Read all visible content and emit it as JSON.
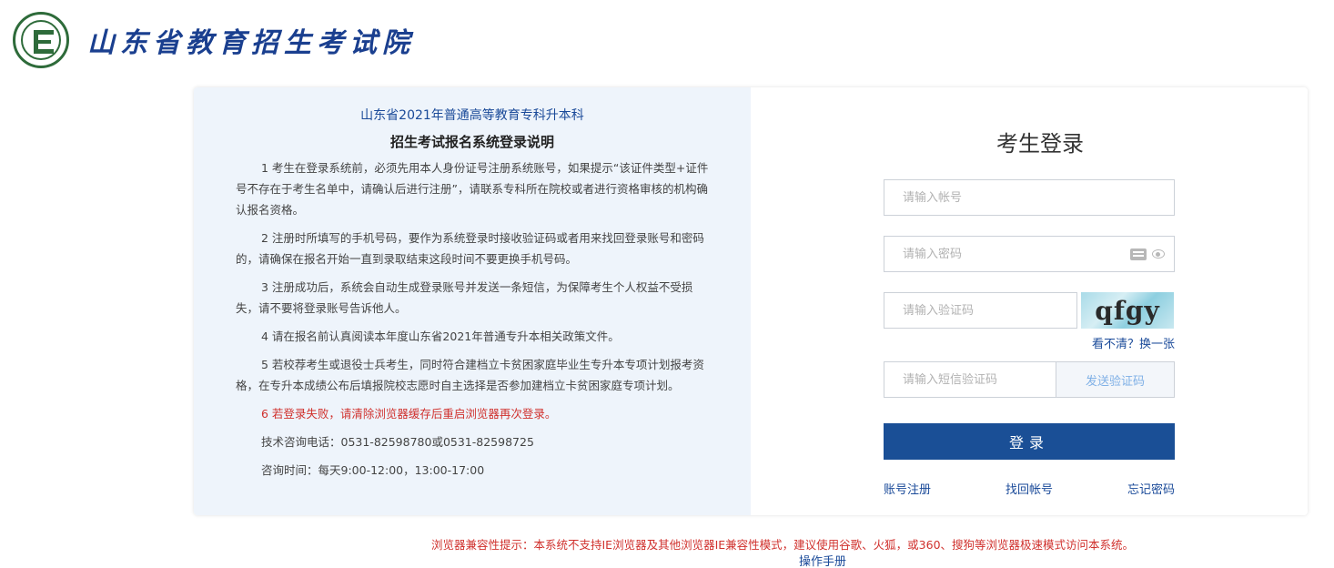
{
  "header": {
    "site_name": "山东省教育招生考试院"
  },
  "info": {
    "title": "山东省2021年普通高等教育专科升本科",
    "subtitle": "招生考试报名系统登录说明",
    "items": [
      "1 考生在登录系统前，必须先用本人身份证号注册系统账号，如果提示“该证件类型+证件号不存在于考生名单中，请确认后进行注册”，请联系专科所在院校或者进行资格审核的机构确认报名资格。",
      "2 注册时所填写的手机号码，要作为系统登录时接收验证码或者用来找回登录账号和密码的，请确保在报名开始一直到录取结束这段时间不要更换手机号码。",
      "3 注册成功后，系统会自动生成登录账号并发送一条短信，为保障考生个人权益不受损失，请不要将登录账号告诉他人。",
      "4 请在报名前认真阅读本年度山东省2021年普通专升本相关政策文件。",
      "5 若校荐考生或退役士兵考生，同时符合建档立卡贫困家庭毕业生专升本专项计划报考资格，在专升本成绩公布后填报院校志愿时自主选择是否参加建档立卡贫困家庭专项计划。"
    ],
    "warning": "6 若登录失败，请清除浏览器缓存后重启浏览器再次登录。",
    "phone": "技术咨询电话：0531-82598780或0531-82598725",
    "hours": "咨询时间：每天9:00-12:00，13:00-17:00"
  },
  "login": {
    "title": "考生登录",
    "account_placeholder": "请输入帐号",
    "password_placeholder": "请输入密码",
    "captcha_placeholder": "请输入验证码",
    "captcha_text": "qfgy",
    "captcha_refresh": "看不清？换一张",
    "sms_placeholder": "请输入短信验证码",
    "sms_button": "发送验证码",
    "submit": "登录",
    "register": "账号注册",
    "find_account": "找回帐号",
    "forgot_password": "忘记密码"
  },
  "footer": {
    "browser_warning": "浏览器兼容性提示：本系统不支持IE浏览器及其他浏览器IE兼容性模式，建议使用谷歌、火狐，或360、搜狗等浏览器极速模式访问本系统。",
    "manual": "操作手册"
  },
  "colors": {
    "brand_blue": "#1a4f96",
    "warning_red": "#d0312d",
    "info_bg": "#eef4fb"
  }
}
